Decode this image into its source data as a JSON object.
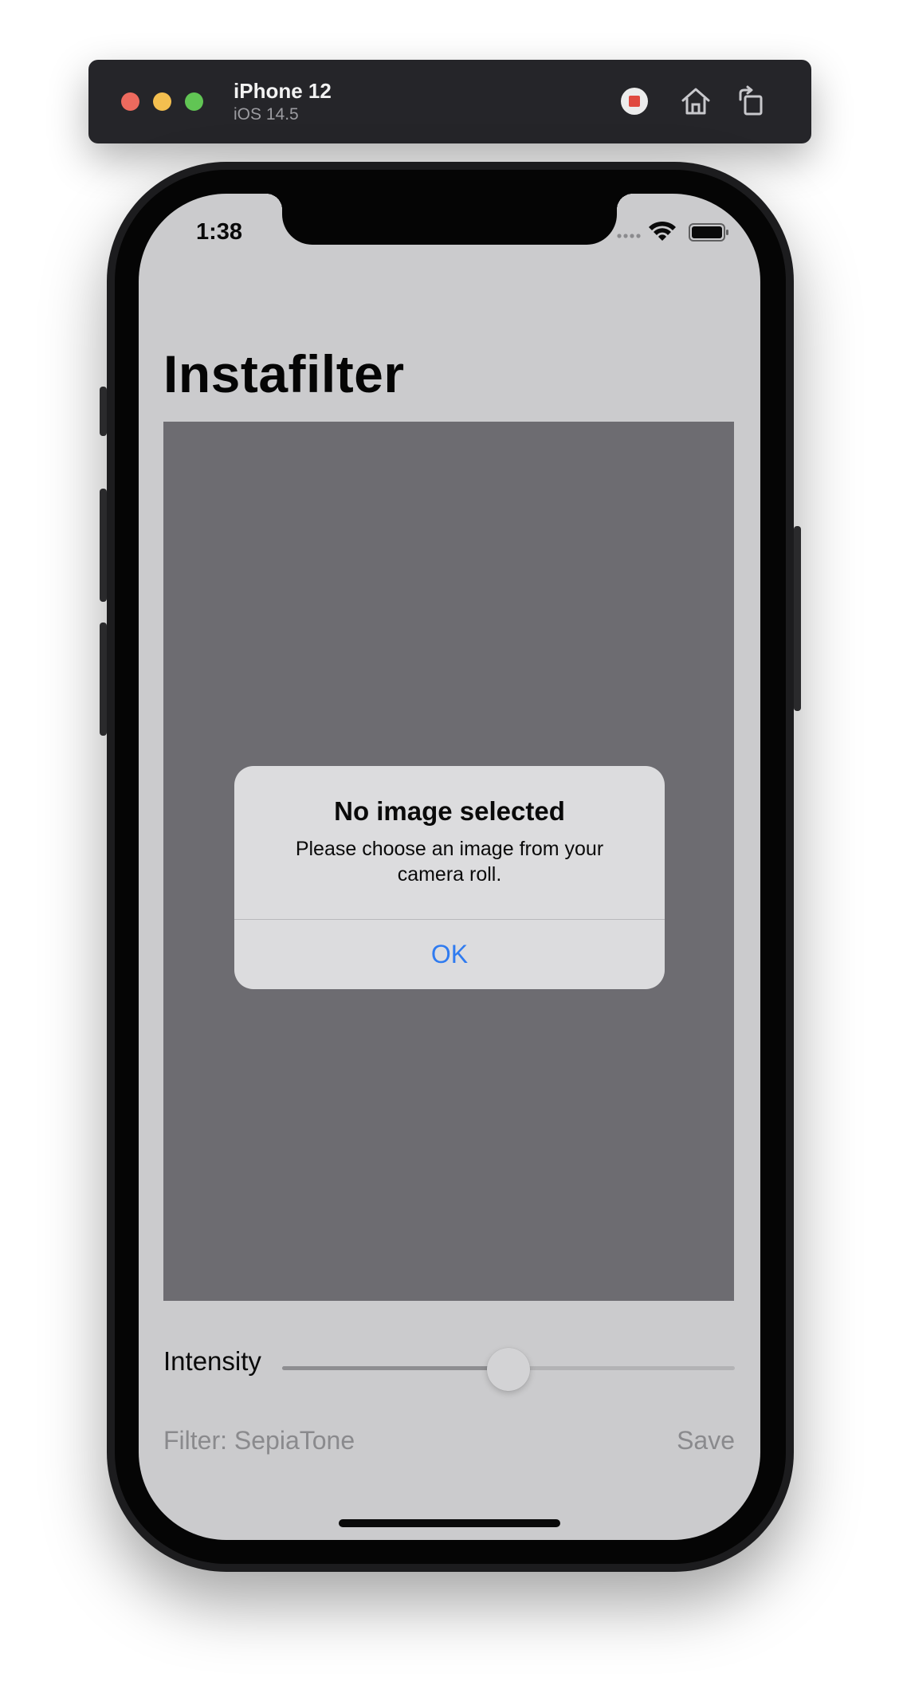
{
  "simulator": {
    "device_name": "iPhone 12",
    "os_version": "iOS 14.5",
    "toolbar": {
      "stop_icon": "stop-record-icon",
      "home_icon": "home-icon",
      "rotate_icon": "rotate-icon"
    },
    "window_controls": [
      "close",
      "minimize",
      "zoom"
    ]
  },
  "status_bar": {
    "time": "1:38",
    "icons": [
      "signal-icon",
      "wifi-icon",
      "battery-icon"
    ]
  },
  "app": {
    "title": "Instafilter",
    "intensity_label": "Intensity",
    "intensity_value": 0.5,
    "filter_button": "Filter: SepiaTone",
    "save_button": "Save"
  },
  "alert": {
    "title": "No image selected",
    "message": "Please choose an image from your camera roll.",
    "ok_button": "OK"
  },
  "colors": {
    "accent": "#2f7bf0",
    "screen_background": "#cbcbcd",
    "image_placeholder": "#6d6c71",
    "disabled_text": "#8a8a8d"
  }
}
